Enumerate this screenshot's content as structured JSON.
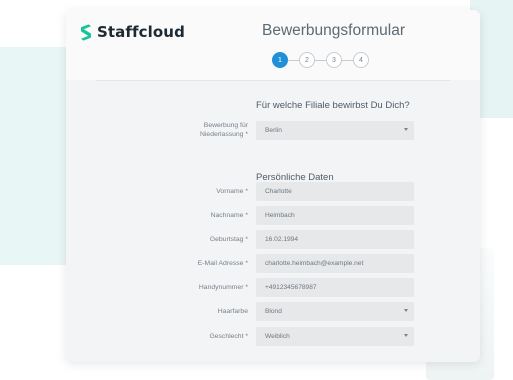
{
  "brand": {
    "name": "Staffcloud",
    "logo_color": "#18c49a"
  },
  "form": {
    "title": "Bewerbungsformular",
    "steps": [
      "1",
      "2",
      "3",
      "4"
    ],
    "active_step": 1,
    "accent_color": "#1f8fd8"
  },
  "sections": {
    "branch_question": "Für welche Filiale bewirbst Du Dich?",
    "personal_data": "Persönliche Daten"
  },
  "fields": {
    "branch": {
      "label": "Bewerbung für Niederlassung *",
      "value": "Berlin",
      "type": "select"
    },
    "first_name": {
      "label": "Vorname *",
      "value": "Charlotte"
    },
    "last_name": {
      "label": "Nachname *",
      "value": "Heimbach"
    },
    "birthday": {
      "label": "Geburtstag *",
      "value": "16.02.1994"
    },
    "email": {
      "label": "E-Mail Adresse *",
      "value": "charlotte.heimbach@example.net"
    },
    "mobile": {
      "label": "Handynummer *",
      "value": "+4912345678987"
    },
    "hair_color": {
      "label": "Haarfarbe",
      "value": "Blond",
      "type": "select"
    },
    "gender": {
      "label": "Geschlecht *",
      "value": "Weiblich",
      "type": "select"
    }
  },
  "icons": {
    "logo": "staffcloud-s-logo-icon",
    "select_caret": "chevron-down-icon"
  }
}
